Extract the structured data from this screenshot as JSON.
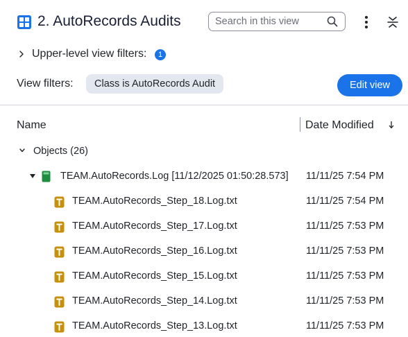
{
  "header": {
    "title": "2. AutoRecords Audits",
    "search_placeholder": "Search in this view"
  },
  "upper_filters": {
    "label": "Upper-level view filters:",
    "count": "1"
  },
  "view_filters": {
    "label": "View filters:",
    "chip": "Class is AutoRecords Audit",
    "edit_label": "Edit view"
  },
  "columns": {
    "name": "Name",
    "date_modified": "Date Modified"
  },
  "group": {
    "label": "Objects (26)"
  },
  "parent": {
    "name": "TEAM.AutoRecords.Log [11/12/2025 01:50:28.573]",
    "date": "11/11/25 7:54 PM",
    "icon": "green-document-icon"
  },
  "rows": [
    {
      "name": "TEAM.AutoRecords_Step_18.Log.txt",
      "date": "11/11/25 7:54 PM",
      "icon": "text-file-icon"
    },
    {
      "name": "TEAM.AutoRecords_Step_17.Log.txt",
      "date": "11/11/25 7:53 PM",
      "icon": "text-file-icon"
    },
    {
      "name": "TEAM.AutoRecords_Step_16.Log.txt",
      "date": "11/11/25 7:53 PM",
      "icon": "text-file-icon"
    },
    {
      "name": "TEAM.AutoRecords_Step_15.Log.txt",
      "date": "11/11/25 7:53 PM",
      "icon": "text-file-icon"
    },
    {
      "name": "TEAM.AutoRecords_Step_14.Log.txt",
      "date": "11/11/25 7:53 PM",
      "icon": "text-file-icon"
    },
    {
      "name": "TEAM.AutoRecords_Step_13.Log.txt",
      "date": "11/11/25 7:53 PM",
      "icon": "text-file-icon"
    }
  ],
  "colors": {
    "accent": "#1a73e8",
    "text_file_icon": "#c8900a",
    "doc_icon": "#1e8e3e",
    "chip_bg": "#e3e8f0"
  }
}
